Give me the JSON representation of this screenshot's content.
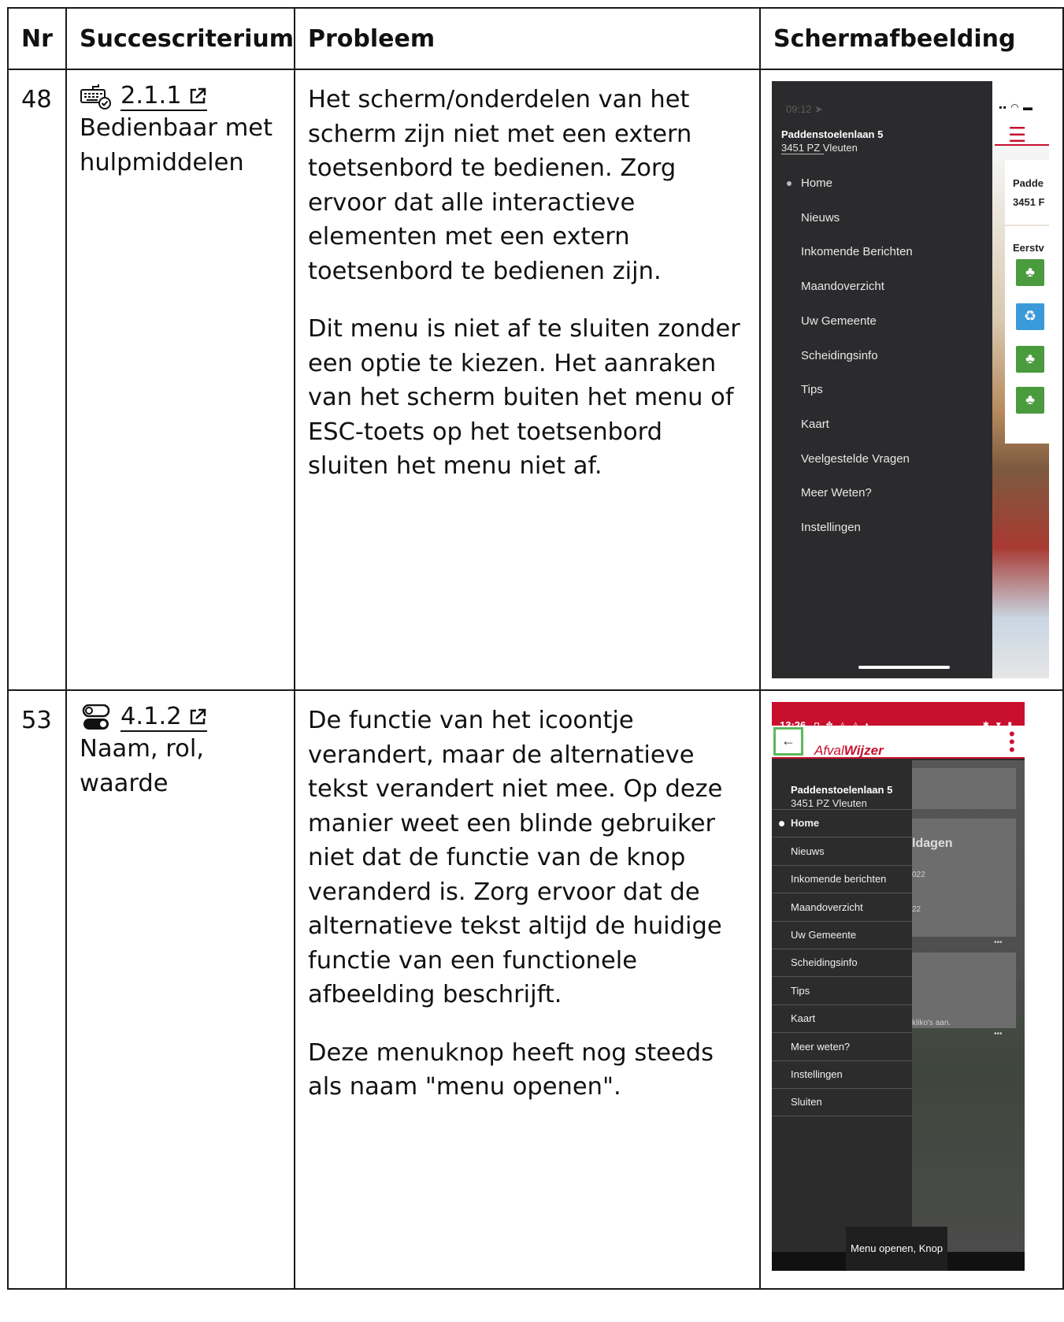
{
  "headers": {
    "nr": "Nr",
    "criterion": "Succescriterium",
    "problem": "Probleem",
    "screenshot": "Schermafbeelding"
  },
  "rows": [
    {
      "nr": "48",
      "criterion_code": "2.1.1",
      "criterion_name": "Bedienbaar met hulpmiddelen",
      "criterion_icon": "keyboard-check-icon",
      "problem_paragraphs": [
        "Het scherm/onderdelen van het scherm zijn niet met een extern toetsenbord te bedienen. Zorg ervoor dat alle interactieve elementen met een extern toetsenbord te bedienen zijn.",
        "Dit menu is niet af te sluiten zonder een optie te kiezen. Het aanraken van het scherm buiten het menu of ESC-toets op het toetsenbord sluiten het menu niet af."
      ],
      "screenshot": {
        "status_time": "09:12",
        "address_line1": "Paddenstoelenlaan 5",
        "address_line2": "3451 PZ Vleuten",
        "menu_items": [
          "Home",
          "Nieuws",
          "Inkomende Berichten",
          "Maandoverzicht",
          "Uw Gemeente",
          "Scheidingsinfo",
          "Tips",
          "Kaart",
          "Veelgestelde Vragen",
          "Meer Weten?",
          "Instellingen"
        ],
        "active_item": "Home",
        "bg_text": [
          "Padde",
          "3451 F",
          "Eerstv"
        ]
      }
    },
    {
      "nr": "53",
      "criterion_code": "4.1.2",
      "criterion_name": "Naam, rol, waarde",
      "criterion_icon": "toggle-switch-icon",
      "problem_paragraphs": [
        "De functie van het icoontje verandert, maar de alternatieve tekst verandert niet mee. Op deze manier weet een blinde gebruiker niet dat de functie van de knop veranderd is. Zorg ervoor dat de alternatieve tekst altijd de huidige functie van een functionele afbeelding beschrijft.",
        "Deze menuknop heeft nog steeds als naam \"menu openen\"."
      ],
      "screenshot": {
        "status_time": "13:26",
        "app_logo_part1": "Afval",
        "app_logo_part2": "Wijzer",
        "address_line1": "Paddenstoelenlaan 5",
        "address_line2": "3451 PZ Vleuten",
        "menu_items": [
          "Home",
          "Nieuws",
          "Inkomende berichten",
          "Maandoverzicht",
          "Uw Gemeente",
          "Scheidingsinfo",
          "Tips",
          "Kaart",
          "Meer weten?",
          "Instellingen",
          "Sluiten"
        ],
        "active_item": "Home",
        "tooltip": "Menu openen, Knop",
        "bg_text": [
          "ldagen",
          "022",
          "22",
          "•••",
          "•••",
          "kliko's aan."
        ]
      }
    }
  ],
  "colors": {
    "brand_red": "#c8102e",
    "focus_green": "#5cb85c",
    "drawer_dark": "#2b2b2d"
  }
}
